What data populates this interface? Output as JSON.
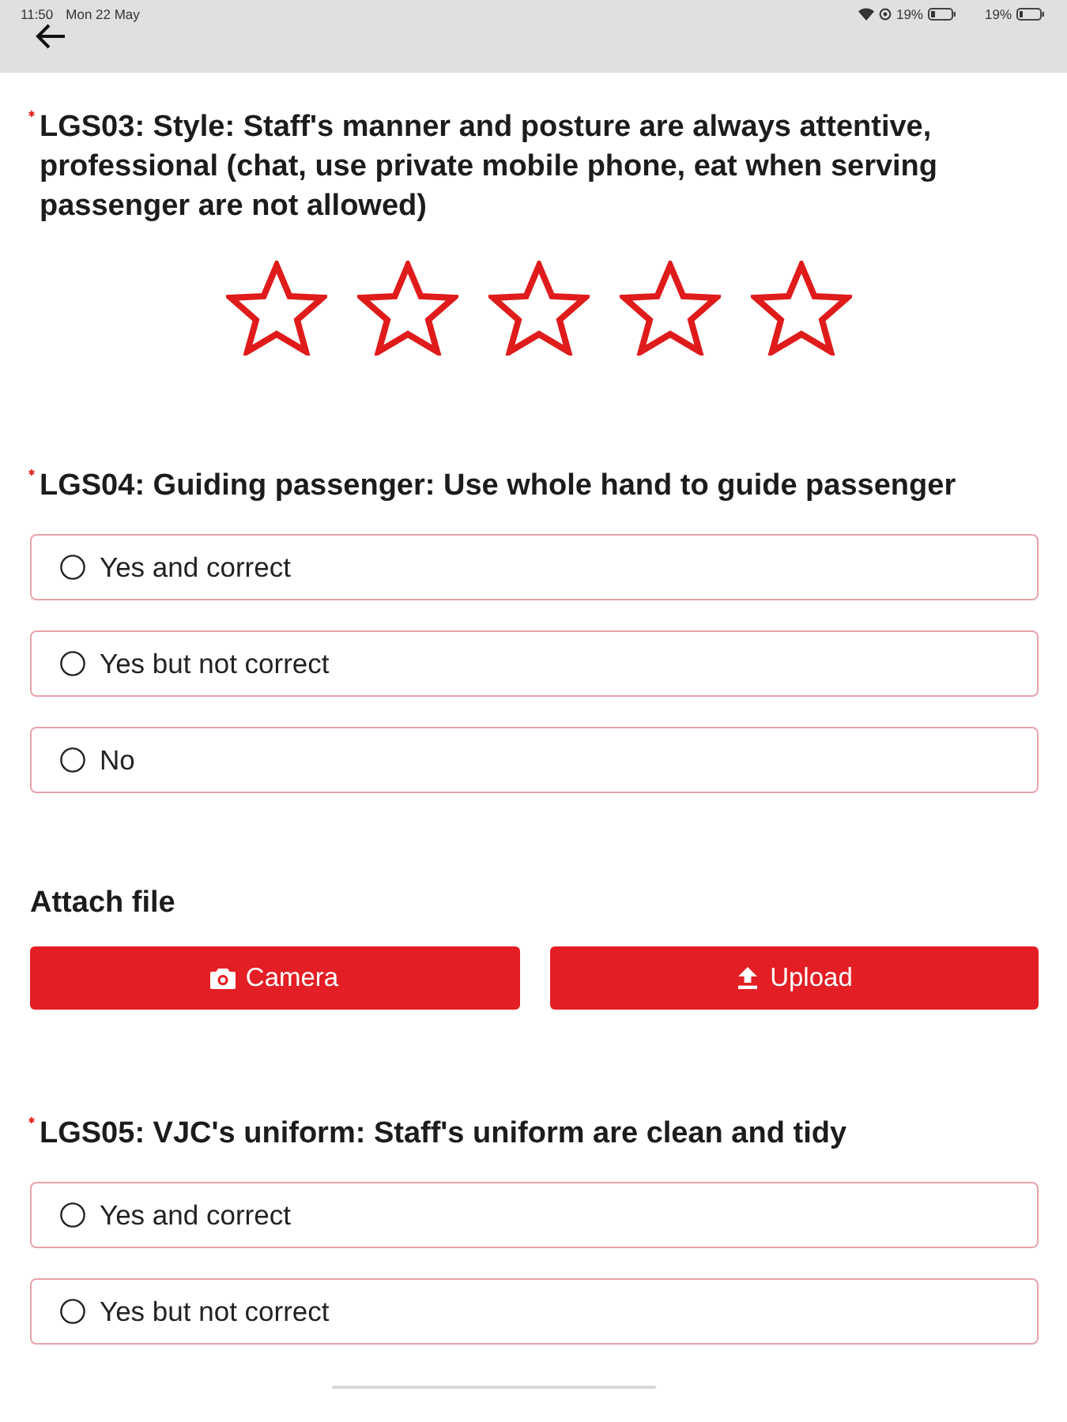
{
  "status_bar": {
    "time": "11:50",
    "date": "Mon 22 May",
    "battery": "19%",
    "battery_2": "19%"
  },
  "questions": [
    {
      "kind": "rating",
      "required": true,
      "title": "LGS03: Style: Staff's manner and posture are always attentive, professional (chat, use private mobile phone, eat when serving passenger are not allowed)",
      "stars": 0
    },
    {
      "kind": "choice",
      "required": true,
      "title": "LGS04: Guiding passenger: Use whole hand to guide passenger",
      "options": [
        {
          "label": "Yes and correct",
          "selected": false
        },
        {
          "label": "Yes but not correct",
          "selected": false
        },
        {
          "label": "No",
          "selected": false
        }
      ]
    },
    {
      "kind": "attachment",
      "title": "Attach file",
      "buttons": [
        "Camera",
        "Upload"
      ]
    },
    {
      "kind": "choice",
      "required": true,
      "title": "LGS05: VJC's uniform: Staff's uniform are clean and tidy",
      "options": [
        {
          "label": "Yes and correct",
          "selected": false
        },
        {
          "label": "Yes but not correct",
          "selected": false
        }
      ]
    }
  ]
}
